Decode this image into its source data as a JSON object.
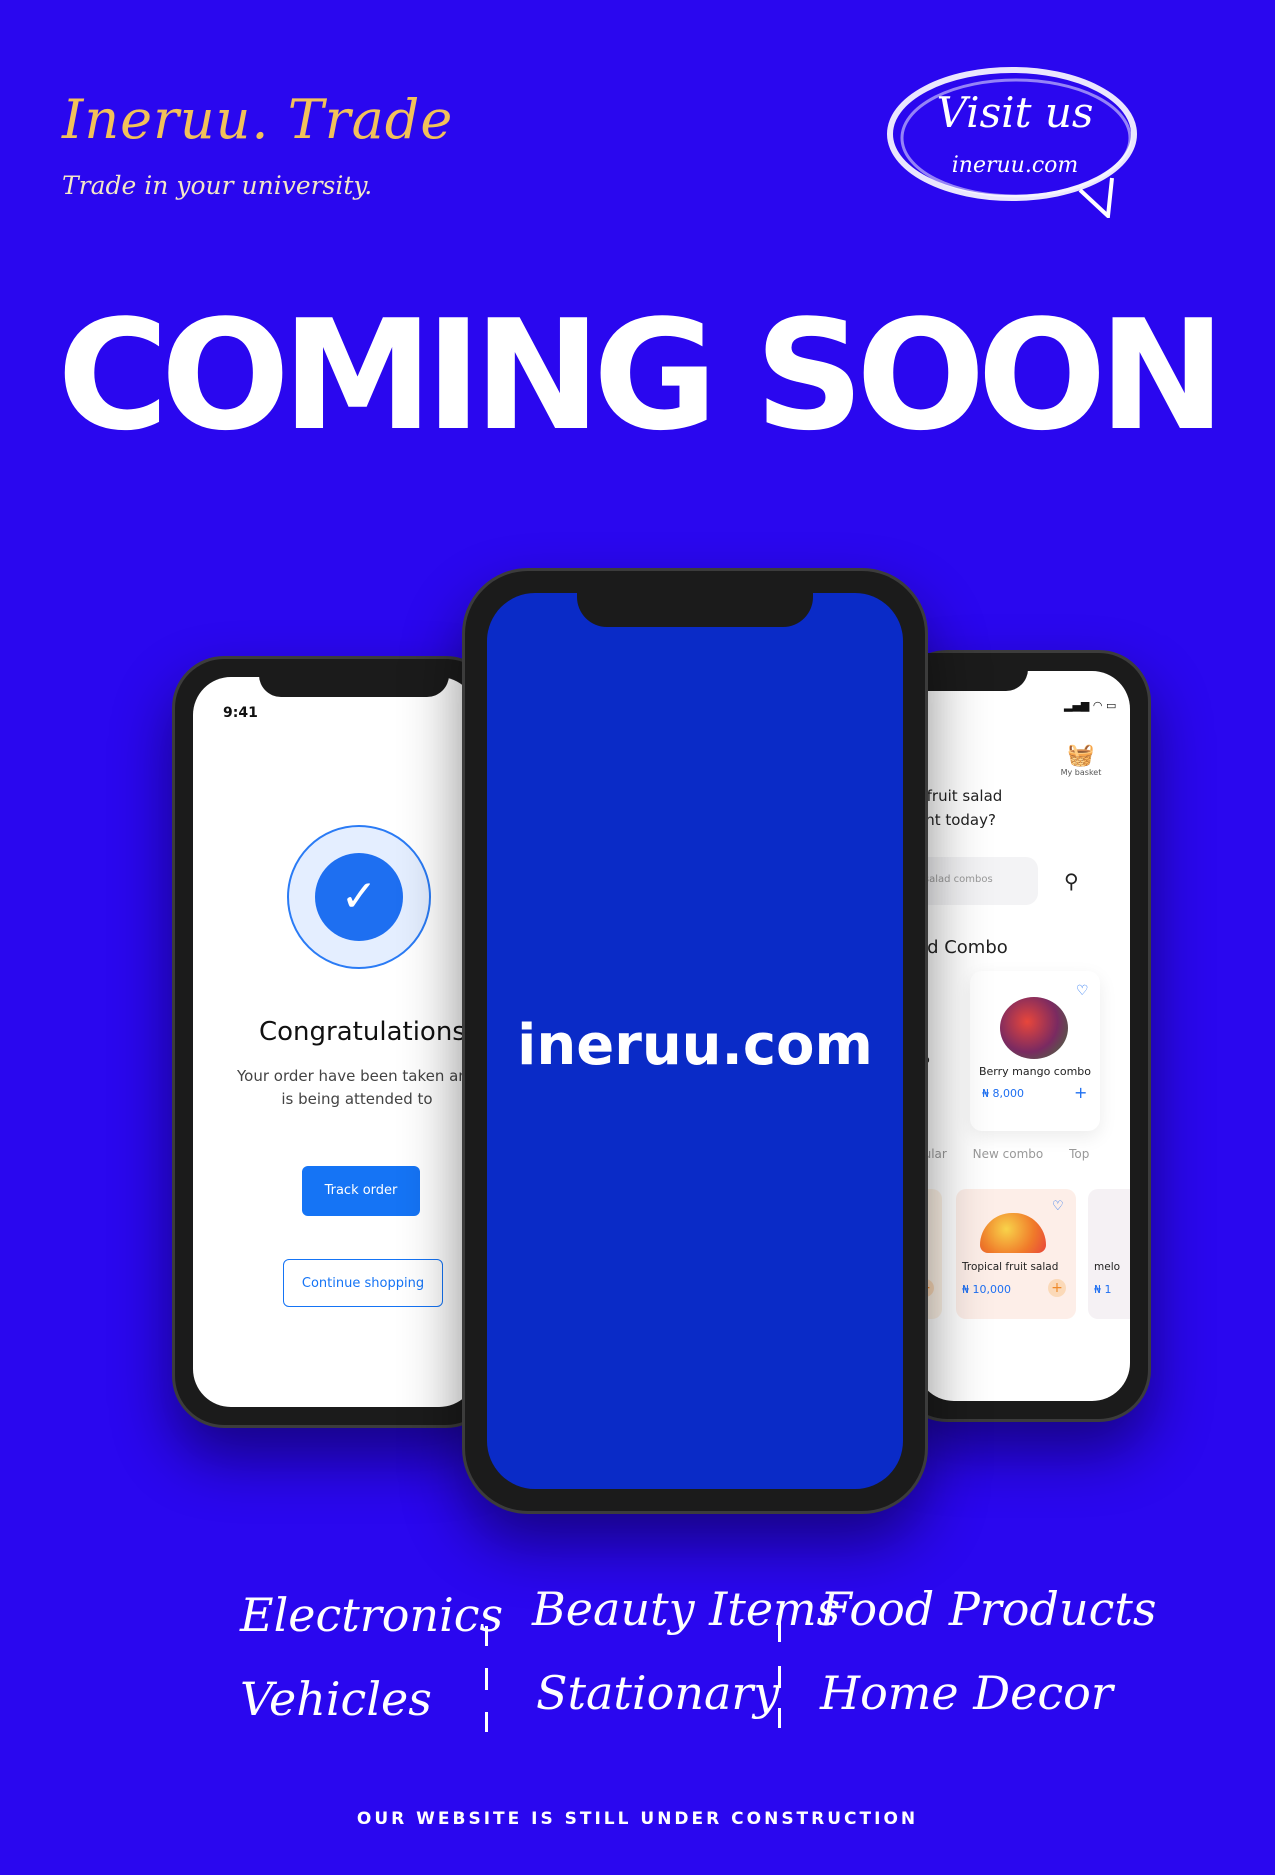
{
  "brand": {
    "name": "Ineruu. Trade",
    "tagline": "Trade in your university."
  },
  "visit": {
    "title": "Visit us",
    "url": "ineruu.com"
  },
  "headline": "COMING SOON",
  "center_phone": {
    "url": "ineruu.com"
  },
  "left_phone": {
    "time": "9:41",
    "title": "Congratulations!!!",
    "message_line1": "Your order have been taken and",
    "message_line2": "is being attended to",
    "track_label": "Track order",
    "continue_label": "Continue shopping"
  },
  "right_phone": {
    "basket_label": "My basket",
    "question_line1": "t fruit salad",
    "question_line2": "ant today?",
    "search_placeholder": "it salad combos",
    "section_title": "ed Combo",
    "left_card_suffix": "bo",
    "card1": {
      "name": "Berry mango combo",
      "price": "₦ 8,000"
    },
    "tabs": [
      "pular",
      "New combo",
      "Top"
    ],
    "card2": {
      "name": "Tropical fruit salad",
      "price": "₦ 10,000"
    },
    "card3": {
      "name": "melo",
      "price": "₦ 1"
    }
  },
  "categories": {
    "col1": [
      "Electronics",
      "Vehicles"
    ],
    "col2": [
      "Beauty Items",
      "Stationary"
    ],
    "col3": [
      "Food Products",
      "Home Decor"
    ]
  },
  "footer": "OUR WEBSITE IS STILL UNDER CONSTRUCTION",
  "colors": {
    "background": "#2a07ef",
    "brand_gold": "#f2c15a",
    "screen_blue": "#0a2bc7",
    "accent_blue": "#1574f5"
  }
}
